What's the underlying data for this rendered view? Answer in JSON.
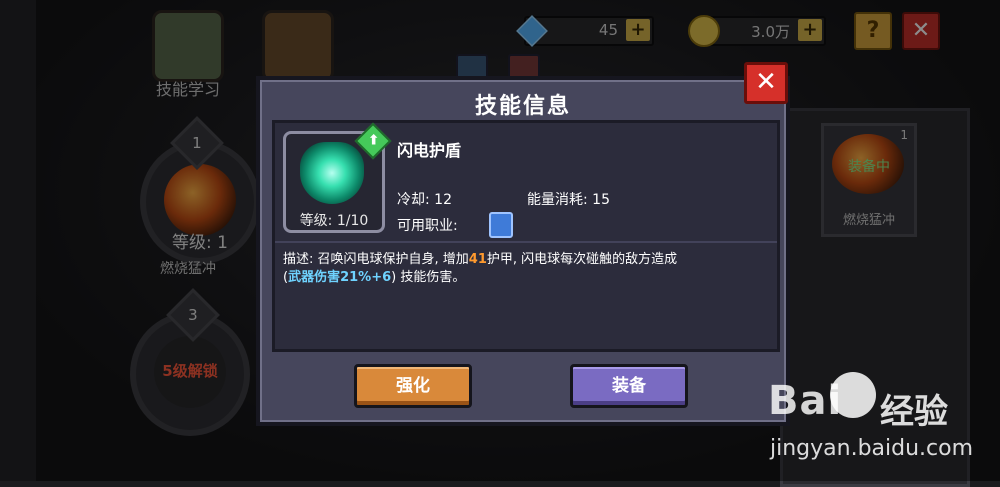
{
  "background": {
    "skill_learn_label": "技能学习",
    "slots": [
      {
        "num": "1",
        "level_text": "等级: 1",
        "name": "燃烧猛冲",
        "locked": false
      },
      {
        "num": "3",
        "unlock_text": "5级解锁",
        "locked": true
      }
    ],
    "resources": {
      "gems": "45",
      "gold": "3.0万"
    },
    "help_label": "?",
    "close_label": "✕",
    "equipped_card": {
      "count": "1",
      "status": "装备中",
      "name": "燃烧猛冲"
    }
  },
  "modal": {
    "title": "技能信息",
    "close_label": "✕",
    "skill": {
      "name": "闪电护盾",
      "level": "等级: 1/10",
      "upgrade_badge": "⬆",
      "cooldown": "冷却: 12",
      "energy": "能量消耗: 15",
      "class_label": "可用职业:",
      "desc_prefix": "描述: 召唤闪电球保护自身, 增加",
      "desc_value": "41",
      "desc_mid": "护甲, 闪电球每次碰触的敌方造成",
      "desc_paren_open": "(",
      "desc_formula": "武器伤害21%+6",
      "desc_paren_close": ")",
      "desc_suffix": " 技能伤害。"
    },
    "buttons": {
      "upgrade": "强化",
      "equip": "装备"
    }
  },
  "watermark": {
    "brand_left": "Bai",
    "brand_right": "经验",
    "url": "jingyan.baidu.com"
  },
  "colors": {
    "modal_bg": "#46465c",
    "upgrade_btn": "#d9893a",
    "equip_btn": "#7a6bc2",
    "close_btn": "#d6302a",
    "highlight_orange": "#ff9a2e",
    "highlight_blue": "#6fd3ff"
  }
}
